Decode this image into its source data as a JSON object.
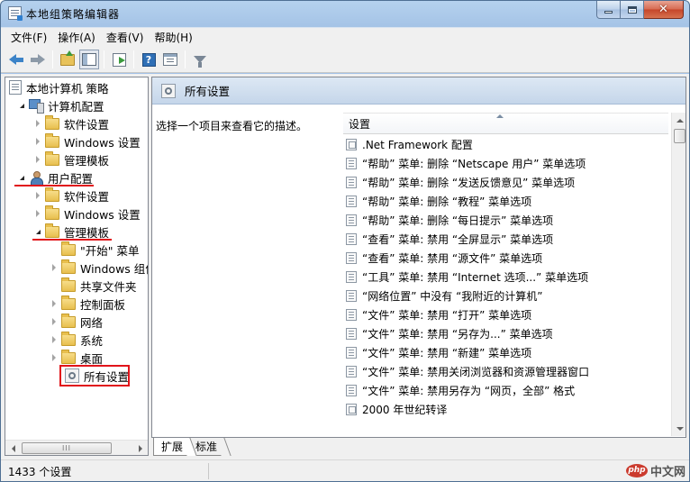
{
  "window": {
    "title": "本地组策略编辑器"
  },
  "menu": [
    "文件(F)",
    "操作(A)",
    "查看(V)",
    "帮助(H)"
  ],
  "toolbar": {
    "icons": [
      "back-arrow-icon",
      "forward-arrow-icon",
      "up-folder-icon",
      "show-hide-tree-icon",
      "export-list-icon",
      "help-icon",
      "properties-icon",
      "filter-icon"
    ]
  },
  "tree": {
    "root": "本地计算机 策略",
    "computer_config": "计算机配置",
    "cc_software": "软件设置",
    "cc_windows": "Windows 设置",
    "cc_admin": "管理模板",
    "user_config": "用户配置",
    "uc_software": "软件设置",
    "uc_windows": "Windows 设置",
    "uc_admin": "管理模板",
    "uc_start": "\"开始\" 菜单",
    "uc_components": "Windows 组件",
    "uc_shared": "共享文件夹",
    "uc_control": "控制面板",
    "uc_network": "网络",
    "uc_system": "系统",
    "uc_desktop": "桌面",
    "uc_all": "所有设置",
    "scroll_grip": "III"
  },
  "right_pane": {
    "title": "所有设置",
    "description": "选择一个项目来查看它的描述。",
    "column_header": "设置"
  },
  "settings_list": [
    ".Net Framework 配置",
    "“帮助” 菜单: 删除 “Netscape 用户” 菜单选项",
    "“帮助” 菜单: 删除 “发送反馈意见” 菜单选项",
    "“帮助” 菜单: 删除 “教程” 菜单选项",
    "“帮助” 菜单: 删除 “每日提示” 菜单选项",
    "“查看” 菜单: 禁用 “全屏显示” 菜单选项",
    "“查看” 菜单: 禁用 “源文件” 菜单选项",
    "“工具” 菜单: 禁用 “Internet 选项...” 菜单选项",
    "“网络位置” 中没有 “我附近的计算机”",
    "“文件” 菜单: 禁用 “打开” 菜单选项",
    "“文件” 菜单: 禁用 “另存为...” 菜单选项",
    "“文件” 菜单: 禁用 “新建” 菜单选项",
    "“文件” 菜单: 禁用关闭浏览器和资源管理器窗口",
    "“文件” 菜单: 禁用另存为 “网页，全部” 格式",
    "2000 年世纪转译"
  ],
  "tabs": {
    "extended": "扩展",
    "standard": "标准"
  },
  "status": {
    "count": "1433 个设置"
  },
  "watermark": {
    "badge": "php",
    "text": "中文网"
  },
  "colors": {
    "highlight_red": "#e1141a",
    "title_blue": "#a4c3e6"
  }
}
